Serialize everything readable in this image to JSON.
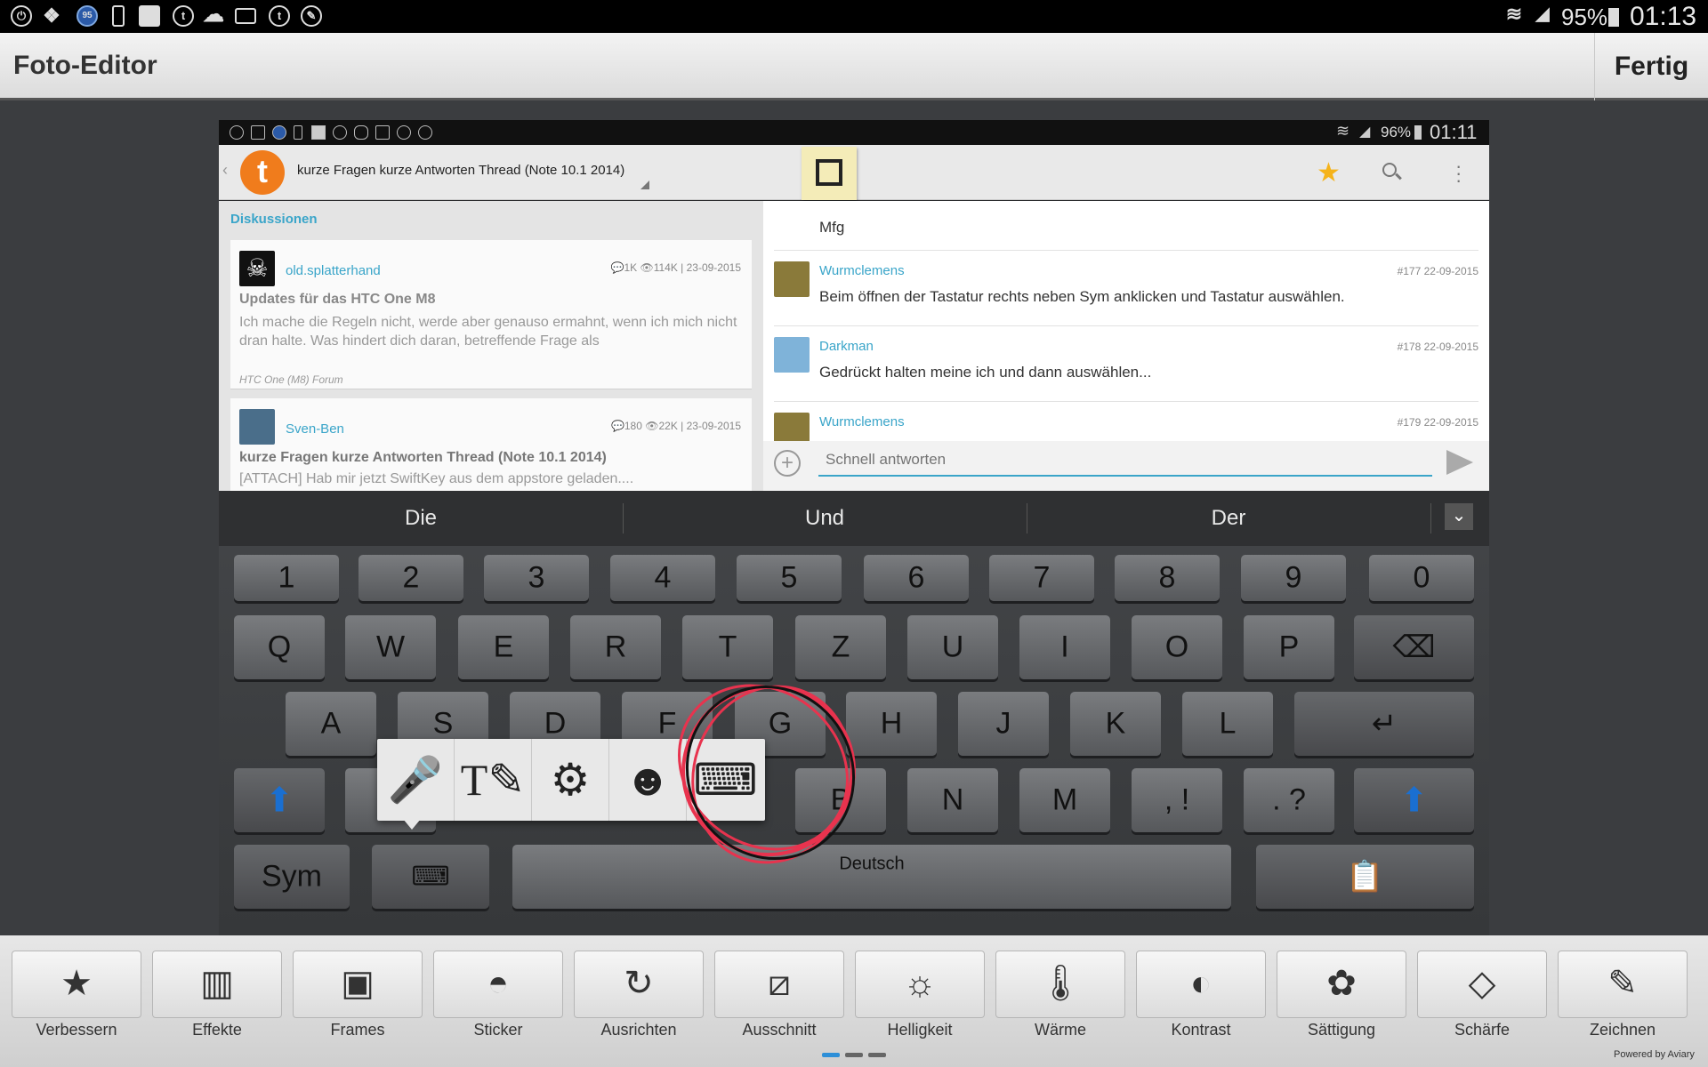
{
  "status": {
    "battery": "95%",
    "time": "01:13"
  },
  "app": {
    "title": "Foto-Editor",
    "done": "Fertig"
  },
  "inner": {
    "status": {
      "battery": "96%",
      "time": "01:11"
    },
    "thread_title": "kurze Fragen kurze Antworten Thread (Note 10.1 2014)",
    "logo_letter": "t",
    "section": "Diskussionen",
    "cards": [
      {
        "user": "old.splatterhand",
        "meta": "💬1K  👁114K | 23-09-2015",
        "title": "Updates für das HTC One M8",
        "body": "Ich mache die Regeln nicht, werde aber genauso ermahnt, wenn ich mich nicht dran halte. Was hindert dich daran, betreffende Frage als",
        "forum": "HTC One (M8) Forum"
      },
      {
        "user": "Sven-Ben",
        "meta": "💬180  👁22K | 23-09-2015",
        "title": "kurze Fragen kurze Antworten Thread (Note 10.1 2014)",
        "body": "[ATTACH] Hab mir jetzt SwiftKey aus dem appstore geladen....",
        "forum": ""
      }
    ],
    "mfg": "Mfg",
    "posts": [
      {
        "user": "Wurmclemens",
        "meta": "#177  22-09-2015",
        "text": "Beim öffnen der Tastatur rechts neben Sym anklicken und Tastatur auswählen."
      },
      {
        "user": "Darkman",
        "meta": "#178  22-09-2015",
        "text": "Gedrückt halten meine ich und dann auswählen..."
      },
      {
        "user": "Wurmclemens",
        "meta": "#179  22-09-2015",
        "text": ""
      }
    ],
    "reply_placeholder": "Schnell antworten"
  },
  "suggestions": [
    "Die",
    "Und",
    "Der"
  ],
  "keyboard": {
    "row_numbers": [
      "1",
      "2",
      "3",
      "4",
      "5",
      "6",
      "7",
      "8",
      "9",
      "0"
    ],
    "row_q": [
      "Q",
      "W",
      "E",
      "R",
      "T",
      "Z",
      "U",
      "I",
      "O",
      "P"
    ],
    "row_a": [
      "A",
      "S",
      "D",
      "F",
      "G",
      "H",
      "J",
      "K",
      "L"
    ],
    "row_y_visible": [
      "B",
      "N",
      "M"
    ],
    "comma": ", !",
    "period": ". ?",
    "sym": "Sym",
    "space": "Deutsch"
  },
  "popup_icons": [
    "microphone-icon",
    "handwriting-icon",
    "settings-icon",
    "emoji-icon",
    "keyboard-icon"
  ],
  "tools": [
    {
      "label": "Verbessern",
      "icon": "★"
    },
    {
      "label": "Effekte",
      "icon": "▥"
    },
    {
      "label": "Frames",
      "icon": "▣"
    },
    {
      "label": "Sticker",
      "icon": "◓"
    },
    {
      "label": "Ausrichten",
      "icon": "↻"
    },
    {
      "label": "Ausschnitt",
      "icon": "⧄"
    },
    {
      "label": "Helligkeit",
      "icon": "☼"
    },
    {
      "label": "Wärme",
      "icon": "🌡"
    },
    {
      "label": "Kontrast",
      "icon": "◐"
    },
    {
      "label": "Sättigung",
      "icon": "✿"
    },
    {
      "label": "Schärfe",
      "icon": "◇"
    },
    {
      "label": "Zeichnen",
      "icon": "✎"
    }
  ],
  "powered_by": "Powered by Aviary",
  "colors": {
    "accent": "#3aa5c9",
    "logo": "#f07c1c",
    "star": "#f5b31a",
    "scribble": "#e8334e"
  }
}
